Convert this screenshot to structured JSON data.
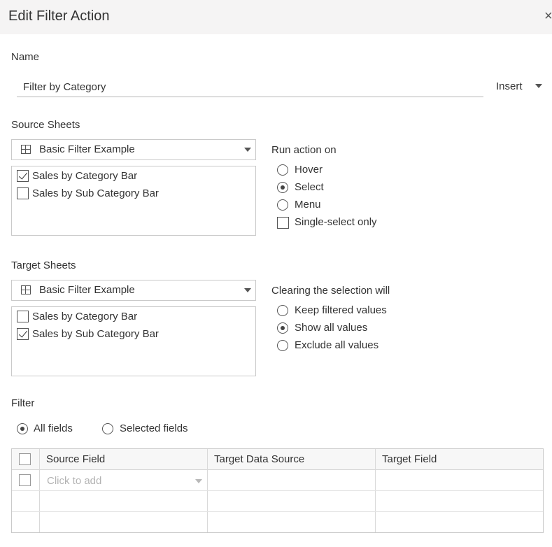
{
  "dialog": {
    "title": "Edit Filter Action",
    "close_glyph": "×"
  },
  "name_section": {
    "label": "Name",
    "value": "Filter by Category",
    "insert_label": "Insert"
  },
  "source": {
    "label": "Source Sheets",
    "dropdown_value": "Basic Filter Example",
    "sheets": [
      {
        "label": "Sales by Category Bar",
        "checked": true
      },
      {
        "label": "Sales by Sub Category Bar",
        "checked": false
      }
    ]
  },
  "run_action": {
    "label": "Run action on",
    "options": [
      {
        "label": "Hover",
        "selected": false
      },
      {
        "label": "Select",
        "selected": true
      },
      {
        "label": "Menu",
        "selected": false
      }
    ],
    "single_select_label": "Single-select only",
    "single_select_checked": false
  },
  "target": {
    "label": "Target Sheets",
    "dropdown_value": "Basic Filter Example",
    "sheets": [
      {
        "label": "Sales by Category Bar",
        "checked": false
      },
      {
        "label": "Sales by Sub Category Bar",
        "checked": true
      }
    ]
  },
  "clearing": {
    "label": "Clearing the selection will",
    "options": [
      {
        "label": "Keep filtered values",
        "selected": false
      },
      {
        "label": "Show all values",
        "selected": true
      },
      {
        "label": "Exclude all values",
        "selected": false
      }
    ]
  },
  "filter": {
    "label": "Filter",
    "modes": [
      {
        "label": "All fields",
        "selected": true
      },
      {
        "label": "Selected fields",
        "selected": false
      }
    ],
    "columns": [
      "Source Field",
      "Target Data Source",
      "Target Field"
    ],
    "add_placeholder": "Click to add"
  },
  "icons": {
    "dialog_close": "close-icon",
    "sheet_dropdown": "grid-table-icon",
    "dropdown_toggle": "chevron-down-icon"
  }
}
